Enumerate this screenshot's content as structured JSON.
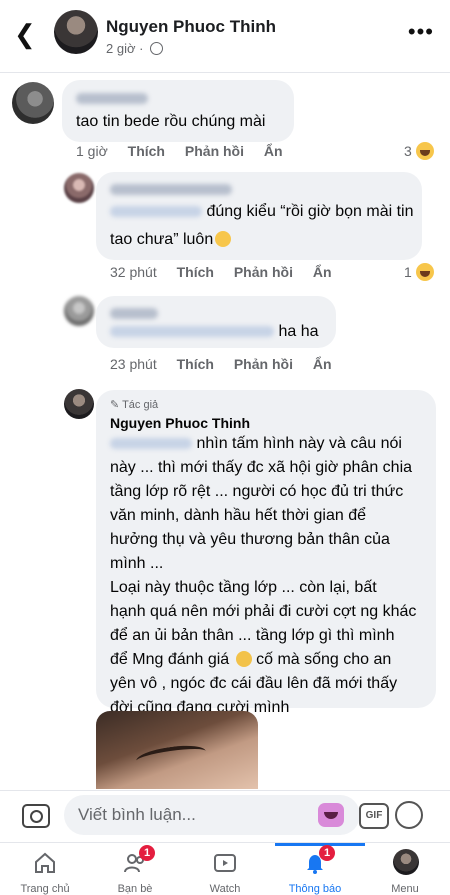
{
  "header": {
    "title": "Nguyen Phuoc Thinh",
    "subtitle": "2 giờ ·"
  },
  "comments": [
    {
      "text": "tao tin bede rồu chúng mài",
      "time": "1 giờ",
      "like": "Thích",
      "reply": "Phản hồi",
      "hide": "Ẩn",
      "reactions": "3"
    },
    {
      "text_line1": "đúng kiểu “rồi giờ bọn mài tin",
      "text_line2": "tao chưa” luôn",
      "time": "32 phút",
      "like": "Thích",
      "reply": "Phản hồi",
      "hide": "Ẩn",
      "reactions": "1"
    },
    {
      "text": "ha ha",
      "time": "23 phút",
      "like": "Thích",
      "reply": "Phản hồi",
      "hide": "Ẩn"
    },
    {
      "author_tag": "Tác giả",
      "name": "Nguyen Phuoc Thinh",
      "lines": [
        "nhìn tấm hình này và câu nói",
        "này ... thì mới thấy đc xã hội giờ phân chia",
        "tầng lớp rõ rệt ... người có học đủ tri thức",
        "văn minh, dành hầu hết thời gian để",
        "hưởng thụ và yêu thương bản thân của",
        "mình ...",
        "Loại này thuộc tầng lớp ... còn lại, bất",
        "hạnh quá nên mới phải đi cười cợt ng khác",
        "để an ủi bản thân ... tầng lớp gì thì mình",
        "để Mng đánh giá",
        "cố mà sống cho an",
        "yên vô , ngóc đc cái đầu lên đã mới thấy",
        "đời cũng đang cười mình"
      ]
    }
  ],
  "composer": {
    "placeholder": "Viết bình luận...",
    "gif": "GIF"
  },
  "tabs": [
    {
      "label": "Trang chủ"
    },
    {
      "label": "Bạn bè",
      "badge": "1"
    },
    {
      "label": "Watch"
    },
    {
      "label": "Thông báo",
      "badge": "1"
    },
    {
      "label": "Menu"
    }
  ],
  "colors": {
    "accent": "#1877f2",
    "badge": "#e41e3f",
    "bubble": "#eff1f4"
  }
}
